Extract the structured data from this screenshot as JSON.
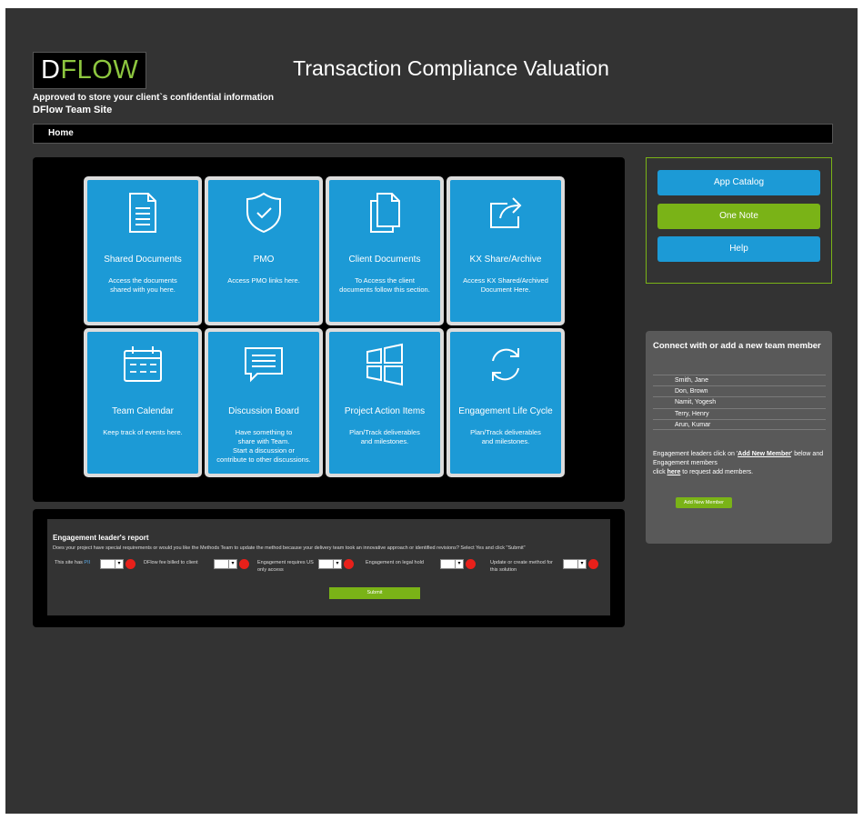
{
  "header": {
    "logo_d": "D",
    "logo_flow": "FLOW",
    "title": "Transaction Compliance Valuation",
    "approved_text": "Approved to store your client`s confidential information",
    "team_site": "DFlow Team Site"
  },
  "nav": {
    "home": "Home"
  },
  "tiles": [
    {
      "title": "Shared Documents",
      "desc": "Access the documents\nshared with you here.",
      "icon": "document-icon"
    },
    {
      "title": "PMO",
      "desc": "Access PMO links here.",
      "icon": "shield-check-icon"
    },
    {
      "title": "Client Documents",
      "desc": "To Access the client\ndocuments follow this section.",
      "icon": "copy-documents-icon"
    },
    {
      "title": "KX Share/Archive",
      "desc": "Access KX Shared/Archived\nDocument Here.",
      "icon": "share-icon"
    },
    {
      "title": "Team Calendar",
      "desc": "Keep track of events here.",
      "icon": "calendar-icon"
    },
    {
      "title": "Discussion Board",
      "desc": "Have something to\nshare with Team.\nStart a discussion or\ncontribute to other discussions.",
      "icon": "chat-bubble-icon"
    },
    {
      "title": "Project Action Items",
      "desc": "Plan/Track deliverables\nand milestones.",
      "icon": "windows-icon"
    },
    {
      "title": "Engagement Life Cycle",
      "desc": "Plan/Track deliverables\nand milestones.",
      "icon": "refresh-cycle-icon"
    }
  ],
  "report": {
    "title": "Engagement leader's report",
    "description": "Does your project have special requirements or would you like the Methods Team to update the method because your delivery team took an innovative approach or identified revisions? Select Yes and click \"Submit\"",
    "field1_prefix": "This site has",
    "field1_highlight": "PII",
    "field2": "DFlow fee billed to client",
    "field3": "Engagement requires US only access",
    "field4": "Engagement on legal hold",
    "field5": "Update or create method for this solution",
    "submit": "Submit"
  },
  "links": {
    "app_catalog": "App Catalog",
    "one_note": "One Note",
    "help": "Help"
  },
  "team": {
    "heading": "Connect with or add a new team member",
    "members": [
      "Smith, Jane",
      "Don, Brown",
      "Namit, Yogesh",
      "Terry, Henry",
      "Arun, Kumar"
    ],
    "engage_1": "Engagement leaders click on '",
    "engage_link": "Add New Member",
    "engage_2": "' below and Engagement members",
    "engage_3": "click ",
    "engage_here": "here",
    "engage_4": " to request add members.",
    "add_member": "Add New Member"
  },
  "colors": {
    "tile_blue": "#1c9ad6",
    "accent_green": "#7ab317",
    "logo_green": "#8dc63f",
    "background": "#333333",
    "clear_red": "#e8201a"
  }
}
